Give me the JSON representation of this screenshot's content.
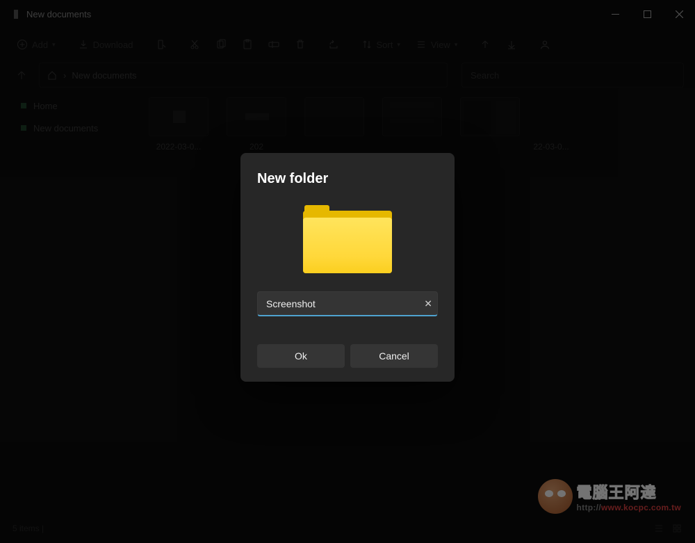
{
  "window": {
    "title": "New documents"
  },
  "toolbar": {
    "add": "Add",
    "download": "Download",
    "sort": "Sort",
    "view": "View"
  },
  "breadcrumb": {
    "current": "New documents"
  },
  "search": {
    "placeholder": "Search"
  },
  "sidebar": {
    "items": [
      {
        "label": "Home"
      },
      {
        "label": "New documents"
      }
    ]
  },
  "thumbs": [
    {
      "label": "2022-03-0..."
    },
    {
      "label": "202"
    },
    {
      "label": ""
    },
    {
      "label": ""
    },
    {
      "label": ""
    },
    {
      "label": "22-03-0..."
    }
  ],
  "modal": {
    "title": "New folder",
    "input_value": "Screenshot",
    "ok": "Ok",
    "cancel": "Cancel"
  },
  "status": {
    "text": "5 items |"
  },
  "watermark": {
    "cn_a": "電腦",
    "cn_b": "王",
    "cn_c": "阿達",
    "url1": "http://",
    "url2": "www.kocpc.com.tw"
  }
}
